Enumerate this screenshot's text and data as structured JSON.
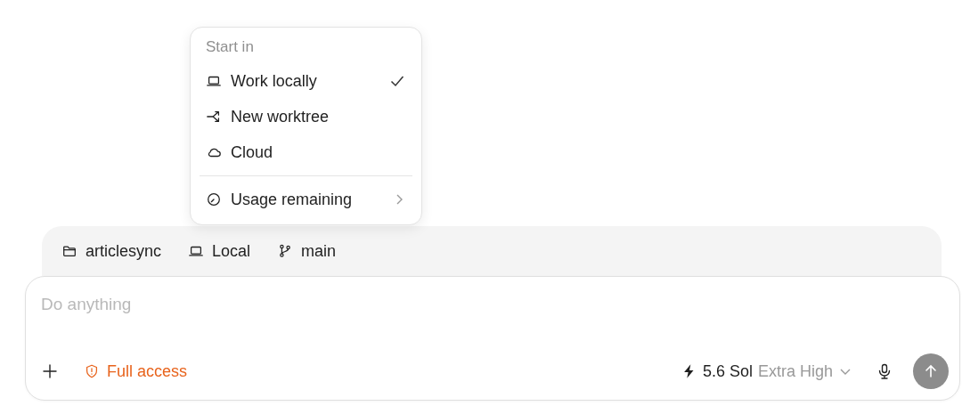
{
  "menu": {
    "header": "Start in",
    "items": [
      {
        "label": "Work locally",
        "kind": "laptop",
        "checked": true
      },
      {
        "label": "New worktree",
        "kind": "worktree",
        "checked": false
      },
      {
        "label": "Cloud",
        "kind": "cloud",
        "checked": false
      }
    ],
    "submenu": {
      "label": "Usage remaining",
      "kind": "gauge"
    }
  },
  "context": [
    {
      "label": "articlesync",
      "kind": "folder"
    },
    {
      "label": "Local",
      "kind": "laptop"
    },
    {
      "label": "main",
      "kind": "branch"
    }
  ],
  "composer": {
    "placeholder": "Do anything",
    "access": "Full access",
    "model": "5.6 Sol",
    "effort": "Extra High"
  }
}
